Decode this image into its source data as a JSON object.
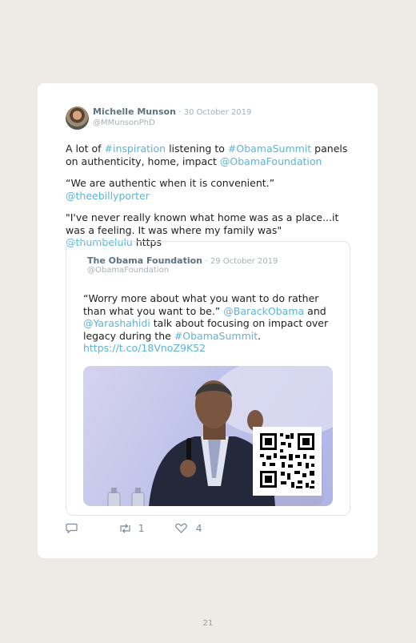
{
  "tweet": {
    "author_name": "Michelle Munson",
    "date": "· 30 October 2019",
    "handle": "@MMunsonPhD",
    "p1": {
      "a": "A lot of ",
      "b": "#inspiration",
      "c": " listening to ",
      "d": "#ObamaSummit",
      "e": " panels on authenticity, home, impact ",
      "f": "@ObamaFoundation"
    },
    "p2": {
      "a": "“We are authentic when it is convenient.” ",
      "b": "@theebillyporter"
    },
    "p3": {
      "a": "\"I've never really known what home was as a place...it was a feeling. It was where my family was\" ",
      "b": "@thumbelulu",
      "c": " https"
    }
  },
  "quote": {
    "author_name": "The Obama Foundation",
    "date": "· 29 October 2019",
    "handle": "@ObamaFoundation",
    "text": {
      "a": "“Worry more about what you want to do rather than what you want to be.” ",
      "b": "@BarackObama",
      "c": " and ",
      "d": "@Yarashahidi",
      "e": " talk about focusing on impact over legacy during the ",
      "f": "#ObamaSummit",
      "g": ".",
      "h": "https://t.co/18VnoZ9K52"
    }
  },
  "actions": {
    "retweets": "1",
    "likes": "4"
  },
  "page_number": "21",
  "colors": {
    "link": "#5bb4d8",
    "name": "#5c7282",
    "meta": "#a7b0b6",
    "background": "#eeebe6"
  },
  "icons": [
    "reply-icon",
    "retweet-icon",
    "heart-icon",
    "qr-code-icon"
  ]
}
